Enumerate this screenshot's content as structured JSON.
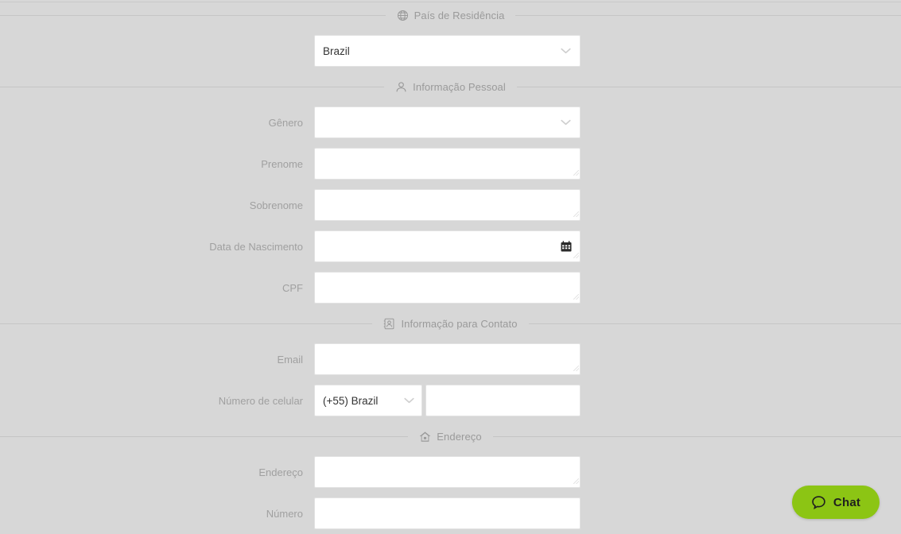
{
  "sections": [
    {
      "id": "country",
      "icon": "globe-icon",
      "title": "País de Residência",
      "fields": [
        {
          "name": "country-of-residence",
          "label": "",
          "type": "select",
          "value": "Brazil",
          "placeholder": ""
        }
      ]
    },
    {
      "id": "personal",
      "icon": "person-icon",
      "title": "Informação Pessoal",
      "fields": [
        {
          "name": "gender",
          "label": "Gênero",
          "type": "select",
          "value": "",
          "placeholder": ""
        },
        {
          "name": "first-name",
          "label": "Prenome",
          "type": "text",
          "value": "",
          "placeholder": ""
        },
        {
          "name": "last-name",
          "label": "Sobrenome",
          "type": "text",
          "value": "",
          "placeholder": ""
        },
        {
          "name": "birth-date",
          "label": "Data de Nascimento",
          "type": "date",
          "value": "",
          "placeholder": ""
        },
        {
          "name": "cpf",
          "label": "CPF",
          "type": "text",
          "value": "",
          "placeholder": ""
        }
      ]
    },
    {
      "id": "contact",
      "icon": "contact-card-icon",
      "title": "Informação para Contato",
      "fields": [
        {
          "name": "email",
          "label": "Email",
          "type": "text",
          "value": "",
          "placeholder": ""
        },
        {
          "name": "mobile-number",
          "label": "Número de celular",
          "type": "phone",
          "value": "",
          "placeholder": "",
          "country_code": "(+55) Brazil"
        }
      ]
    },
    {
      "id": "address",
      "icon": "home-icon",
      "title": "Endereço",
      "fields": [
        {
          "name": "street-address",
          "label": "Endereço",
          "type": "text",
          "value": "",
          "placeholder": ""
        },
        {
          "name": "street-number",
          "label": "Número",
          "type": "text",
          "value": "",
          "placeholder": ""
        }
      ]
    }
  ],
  "chat_widget": {
    "label": "Chat",
    "icon": "chat-bubble-icon",
    "color": "#8cc514"
  }
}
